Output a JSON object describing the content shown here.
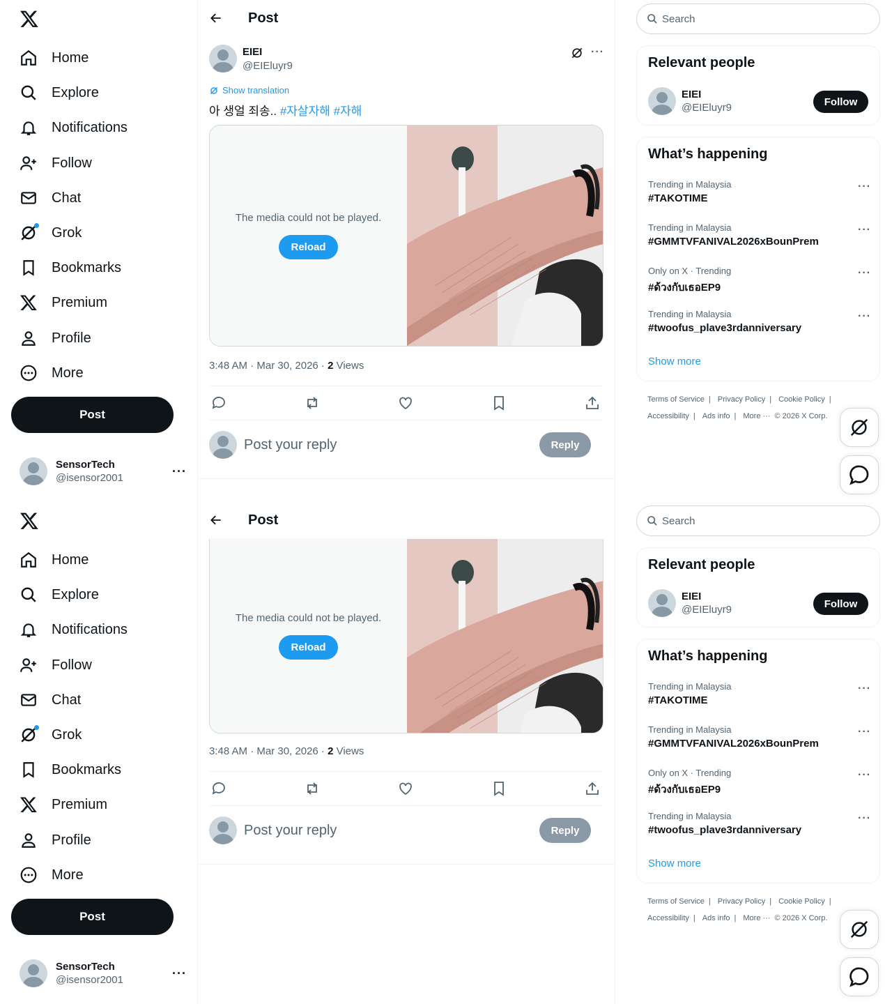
{
  "nav": {
    "items": [
      {
        "label": "Home",
        "icon": "home-icon"
      },
      {
        "label": "Explore",
        "icon": "search-icon"
      },
      {
        "label": "Notifications",
        "icon": "bell-icon"
      },
      {
        "label": "Follow",
        "icon": "person-add-icon"
      },
      {
        "label": "Chat",
        "icon": "mail-icon"
      },
      {
        "label": "Grok",
        "icon": "grok-icon"
      },
      {
        "label": "Bookmarks",
        "icon": "bookmark-icon"
      },
      {
        "label": "Premium",
        "icon": "x-logo-icon"
      },
      {
        "label": "Profile",
        "icon": "person-icon"
      },
      {
        "label": "More",
        "icon": "more-circle-icon"
      }
    ],
    "post_label": "Post",
    "account": {
      "name": "SensorTech",
      "handle": "@isensor2001",
      "more": "···"
    }
  },
  "header": {
    "title": "Post"
  },
  "post": {
    "author_name": "EIEI",
    "author_handle": "@EIEluyr9",
    "show_translation": "Show translation",
    "text_plain": "아 생얼 죄송.. ",
    "tag1": "#자살자해",
    "tag2": "#자해",
    "media_error": "The media could not be played.",
    "reload_label": "Reload",
    "time": "3:48 AM · Mar 30, 2026 · ",
    "views_count": "2",
    "views_label": " Views",
    "more": "···"
  },
  "reply": {
    "placeholder": "Post your reply",
    "button": "Reply"
  },
  "search": {
    "placeholder": "Search"
  },
  "relevant": {
    "title": "Relevant people",
    "name": "EIEI",
    "handle": "@EIEluyr9",
    "follow": "Follow"
  },
  "happening": {
    "title": "What’s happening",
    "trends": [
      {
        "context": "Trending in Malaysia",
        "title": "#TAKOTIME"
      },
      {
        "context": "Trending in Malaysia",
        "title": "#GMMTVFANIVAL2026xBounPrem"
      },
      {
        "context": "Only on X · Trending",
        "title": "#ด้วงกับเธอEP9"
      },
      {
        "context": "Trending in Malaysia",
        "title": "#twoofus_plave3rdanniversary"
      }
    ],
    "show_more": "Show more",
    "trend_more": "···"
  },
  "footer": {
    "terms": "Terms of Service",
    "privacy": "Privacy Policy",
    "cookie": "Cookie Policy",
    "accessibility": "Accessibility",
    "ads": "Ads info",
    "more": "More ···",
    "copyright": "© 2026 X Corp."
  }
}
